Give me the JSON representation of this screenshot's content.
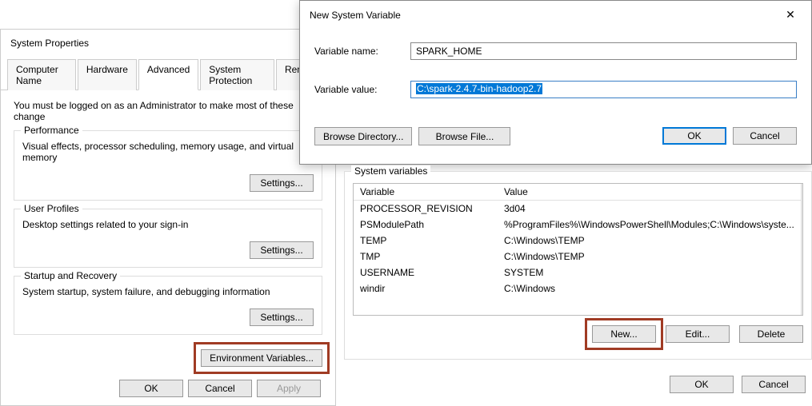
{
  "sysprops": {
    "title": "System Properties",
    "tabs": [
      "Computer Name",
      "Hardware",
      "Advanced",
      "System Protection",
      "Remote"
    ],
    "active_tab": 2,
    "admin_note": "You must be logged on as an Administrator to make most of these change",
    "groups": {
      "performance": {
        "title": "Performance",
        "desc": "Visual effects, processor scheduling, memory usage, and virtual memory",
        "settings_btn": "Settings..."
      },
      "profiles": {
        "title": "User Profiles",
        "desc": "Desktop settings related to your sign-in",
        "settings_btn": "Settings..."
      },
      "startup": {
        "title": "Startup and Recovery",
        "desc": "System startup, system failure, and debugging information",
        "settings_btn": "Settings..."
      }
    },
    "env_btn": "Environment Variables...",
    "ok": "OK",
    "cancel": "Cancel",
    "apply": "Apply"
  },
  "newvar": {
    "title": "New System Variable",
    "name_label": "Variable name:",
    "name_value": "SPARK_HOME",
    "value_label": "Variable value:",
    "value_value": "C:\\spark-2.4.7-bin-hadoop2.7",
    "browse_dir": "Browse Directory...",
    "browse_file": "Browse File...",
    "ok": "OK",
    "cancel": "Cancel"
  },
  "sysvars": {
    "group_title": "System variables",
    "col_var": "Variable",
    "col_val": "Value",
    "rows": [
      {
        "var": "PROCESSOR_REVISION",
        "val": "3d04"
      },
      {
        "var": "PSModulePath",
        "val": "%ProgramFiles%\\WindowsPowerShell\\Modules;C:\\Windows\\syste..."
      },
      {
        "var": "TEMP",
        "val": "C:\\Windows\\TEMP"
      },
      {
        "var": "TMP",
        "val": "C:\\Windows\\TEMP"
      },
      {
        "var": "USERNAME",
        "val": "SYSTEM"
      },
      {
        "var": "windir",
        "val": "C:\\Windows"
      }
    ],
    "new_btn": "New...",
    "edit_btn": "Edit...",
    "delete_btn": "Delete",
    "ok": "OK",
    "cancel": "Cancel"
  }
}
